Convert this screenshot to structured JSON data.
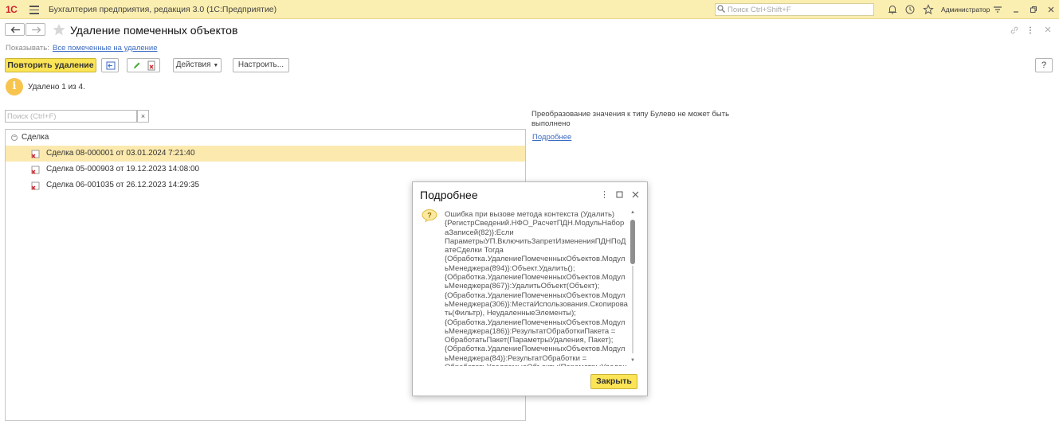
{
  "app": {
    "logo": "1С",
    "title": "Бухгалтерия предприятия, редакция 3.0  (1С:Предприятие)",
    "search_placeholder": "Поиск Ctrl+Shift+F",
    "user": "Администратор"
  },
  "form": {
    "title": "Удаление помеченных объектов",
    "show_label": "Показывать:",
    "show_link": "Все помеченные на удаление",
    "help_label": "?"
  },
  "toolbar": {
    "repeat_label": "Повторить удаление",
    "actions_label": "Действия",
    "settings_label": "Настроить..."
  },
  "info": {
    "text": "Удалено 1 из 4."
  },
  "left": {
    "search_placeholder": "Поиск (Ctrl+F)",
    "clear_label": "×",
    "root_label": "Сделка",
    "items": [
      {
        "label": "Сделка 08-000001 от 03.01.2024 7:21:40"
      },
      {
        "label": "Сделка 05-000903 от 19.12.2023 14:08:00"
      },
      {
        "label": "Сделка 06-001035 от 26.12.2023 14:29:35"
      }
    ]
  },
  "right": {
    "error": "Преобразование значения к типу Булево не может быть выполнено",
    "more_link": "Подробнее"
  },
  "dialog": {
    "title": "Подробнее",
    "text": "Ошибка при вызове метода контекста (Удалить)\n{РегистрСведений.НФО_РасчетПДН.МодульНабораЗаписей(82)}:Если ПараметрыУП.ВключитьЗапретИзмененияПДНПоДатеСделки Тогда\n{Обработка.УдалениеПомеченныхОбъектов.МодульМенеджера(894)}:Объект.Удалить();\n{Обработка.УдалениеПомеченныхОбъектов.МодульМенеджера(867)}:УдалитьОбъект(Объект);\n{Обработка.УдалениеПомеченныхОбъектов.МодульМенеджера(306)}:МестаИспользования.Скопировать(Фильтр), НеудаленныеЭлементы);\n{Обработка.УдалениеПомеченныхОбъектов.МодульМенеджера(186)}:РезультатОбработкиПакета = ОбработатьПакет(ПараметрыУдаления, Пакет);\n{Обработка.УдалениеПомеченныхОбъектов.МодульМенеджера(84)}:РезультатОбработки = ОбработатьУдаляемыеОбъекты(ПараметрыУдаления,",
    "close_label": "Закрыть"
  }
}
